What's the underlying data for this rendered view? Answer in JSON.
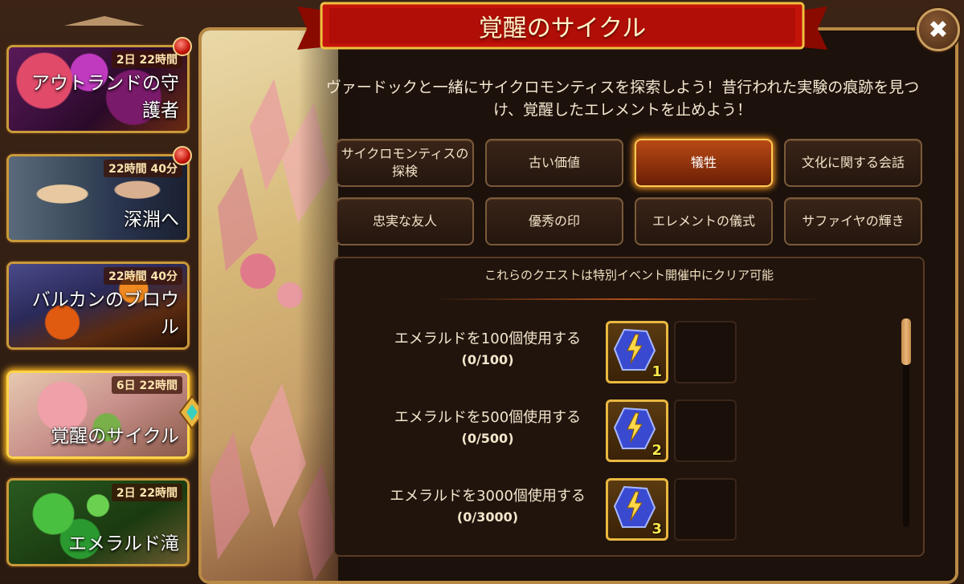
{
  "sidebar": {
    "events": [
      {
        "time": "2日 22時間",
        "title": "アウトランドの守護者",
        "has_notice": true
      },
      {
        "time": "22時間 40分",
        "title": "深淵へ",
        "has_notice": true
      },
      {
        "time": "22時間 40分",
        "title": "バルカンのブロウル",
        "has_notice": false
      },
      {
        "time": "6日 22時間",
        "title": "覚醒のサイクル",
        "has_notice": false,
        "selected": true
      },
      {
        "time": "2日 22時間",
        "title": "エメラルド滝",
        "has_notice": false
      }
    ]
  },
  "panel": {
    "title": "覚醒のサイクル",
    "close_icon": "close-x",
    "description": "ヴァードックと一緒にサイクロモンティスを探索しよう！昔行われた実験の痕跡を見つけ、覚醒したエレメントを止めよう！",
    "tabs": [
      {
        "label": "サイクロモンティスの探検",
        "active": false
      },
      {
        "label": "古い価値",
        "active": false
      },
      {
        "label": "犠牲",
        "active": true
      },
      {
        "label": "文化に関する会話",
        "active": false
      },
      {
        "label": "忠実な友人",
        "active": false
      },
      {
        "label": "優秀の印",
        "active": false
      },
      {
        "label": "エレメントの儀式",
        "active": false
      },
      {
        "label": "サファイヤの輝き",
        "active": false
      }
    ],
    "quests": {
      "header": "これらのクエストは特別イベント開催中にクリア可能",
      "items": [
        {
          "name": "エメラルドを100個使用する",
          "progress": "(0/100)",
          "reward_icon": "lightning-rune",
          "reward_count": "1"
        },
        {
          "name": "エメラルドを500個使用する",
          "progress": "(0/500)",
          "reward_icon": "lightning-rune",
          "reward_count": "2"
        },
        {
          "name": "エメラルドを3000個使用する",
          "progress": "(0/3000)",
          "reward_icon": "lightning-rune",
          "reward_count": "3"
        }
      ]
    }
  },
  "colors": {
    "accent": "#ffcc55",
    "active_tab": "#b84a14",
    "banner": "#c4140a"
  }
}
